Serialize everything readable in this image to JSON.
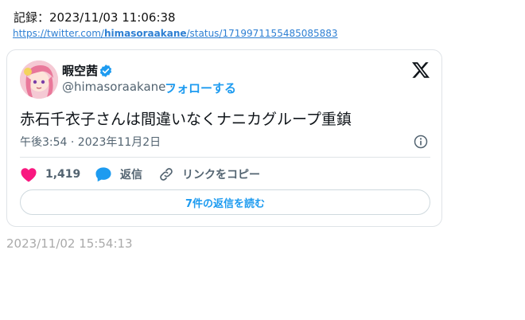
{
  "record": "記録：2023/11/03 11:06:38",
  "link": {
    "prefix": "https://twitter.com/",
    "bold": "himasoraakane",
    "suffix": "/status/1719971155485085883"
  },
  "tweet": {
    "name": "暇空茜",
    "handle": "@himasoraakane",
    "separator": "·",
    "follow_label": "フォローする",
    "text": "赤石千衣子さんは間違いなくナニカグループ重鎮",
    "time": "午後3:54 · 2023年11月2日",
    "likes": "1,419",
    "reply_label": "返信",
    "copy_link_label": "リンクをコピー",
    "read_replies_label": "7件の返信を読む"
  },
  "stamp": "2023/11/02 15:54:13",
  "colors": {
    "accent": "#1d9bf0",
    "like": "#f91880",
    "text": "#0f1419",
    "secondary": "#536471"
  }
}
